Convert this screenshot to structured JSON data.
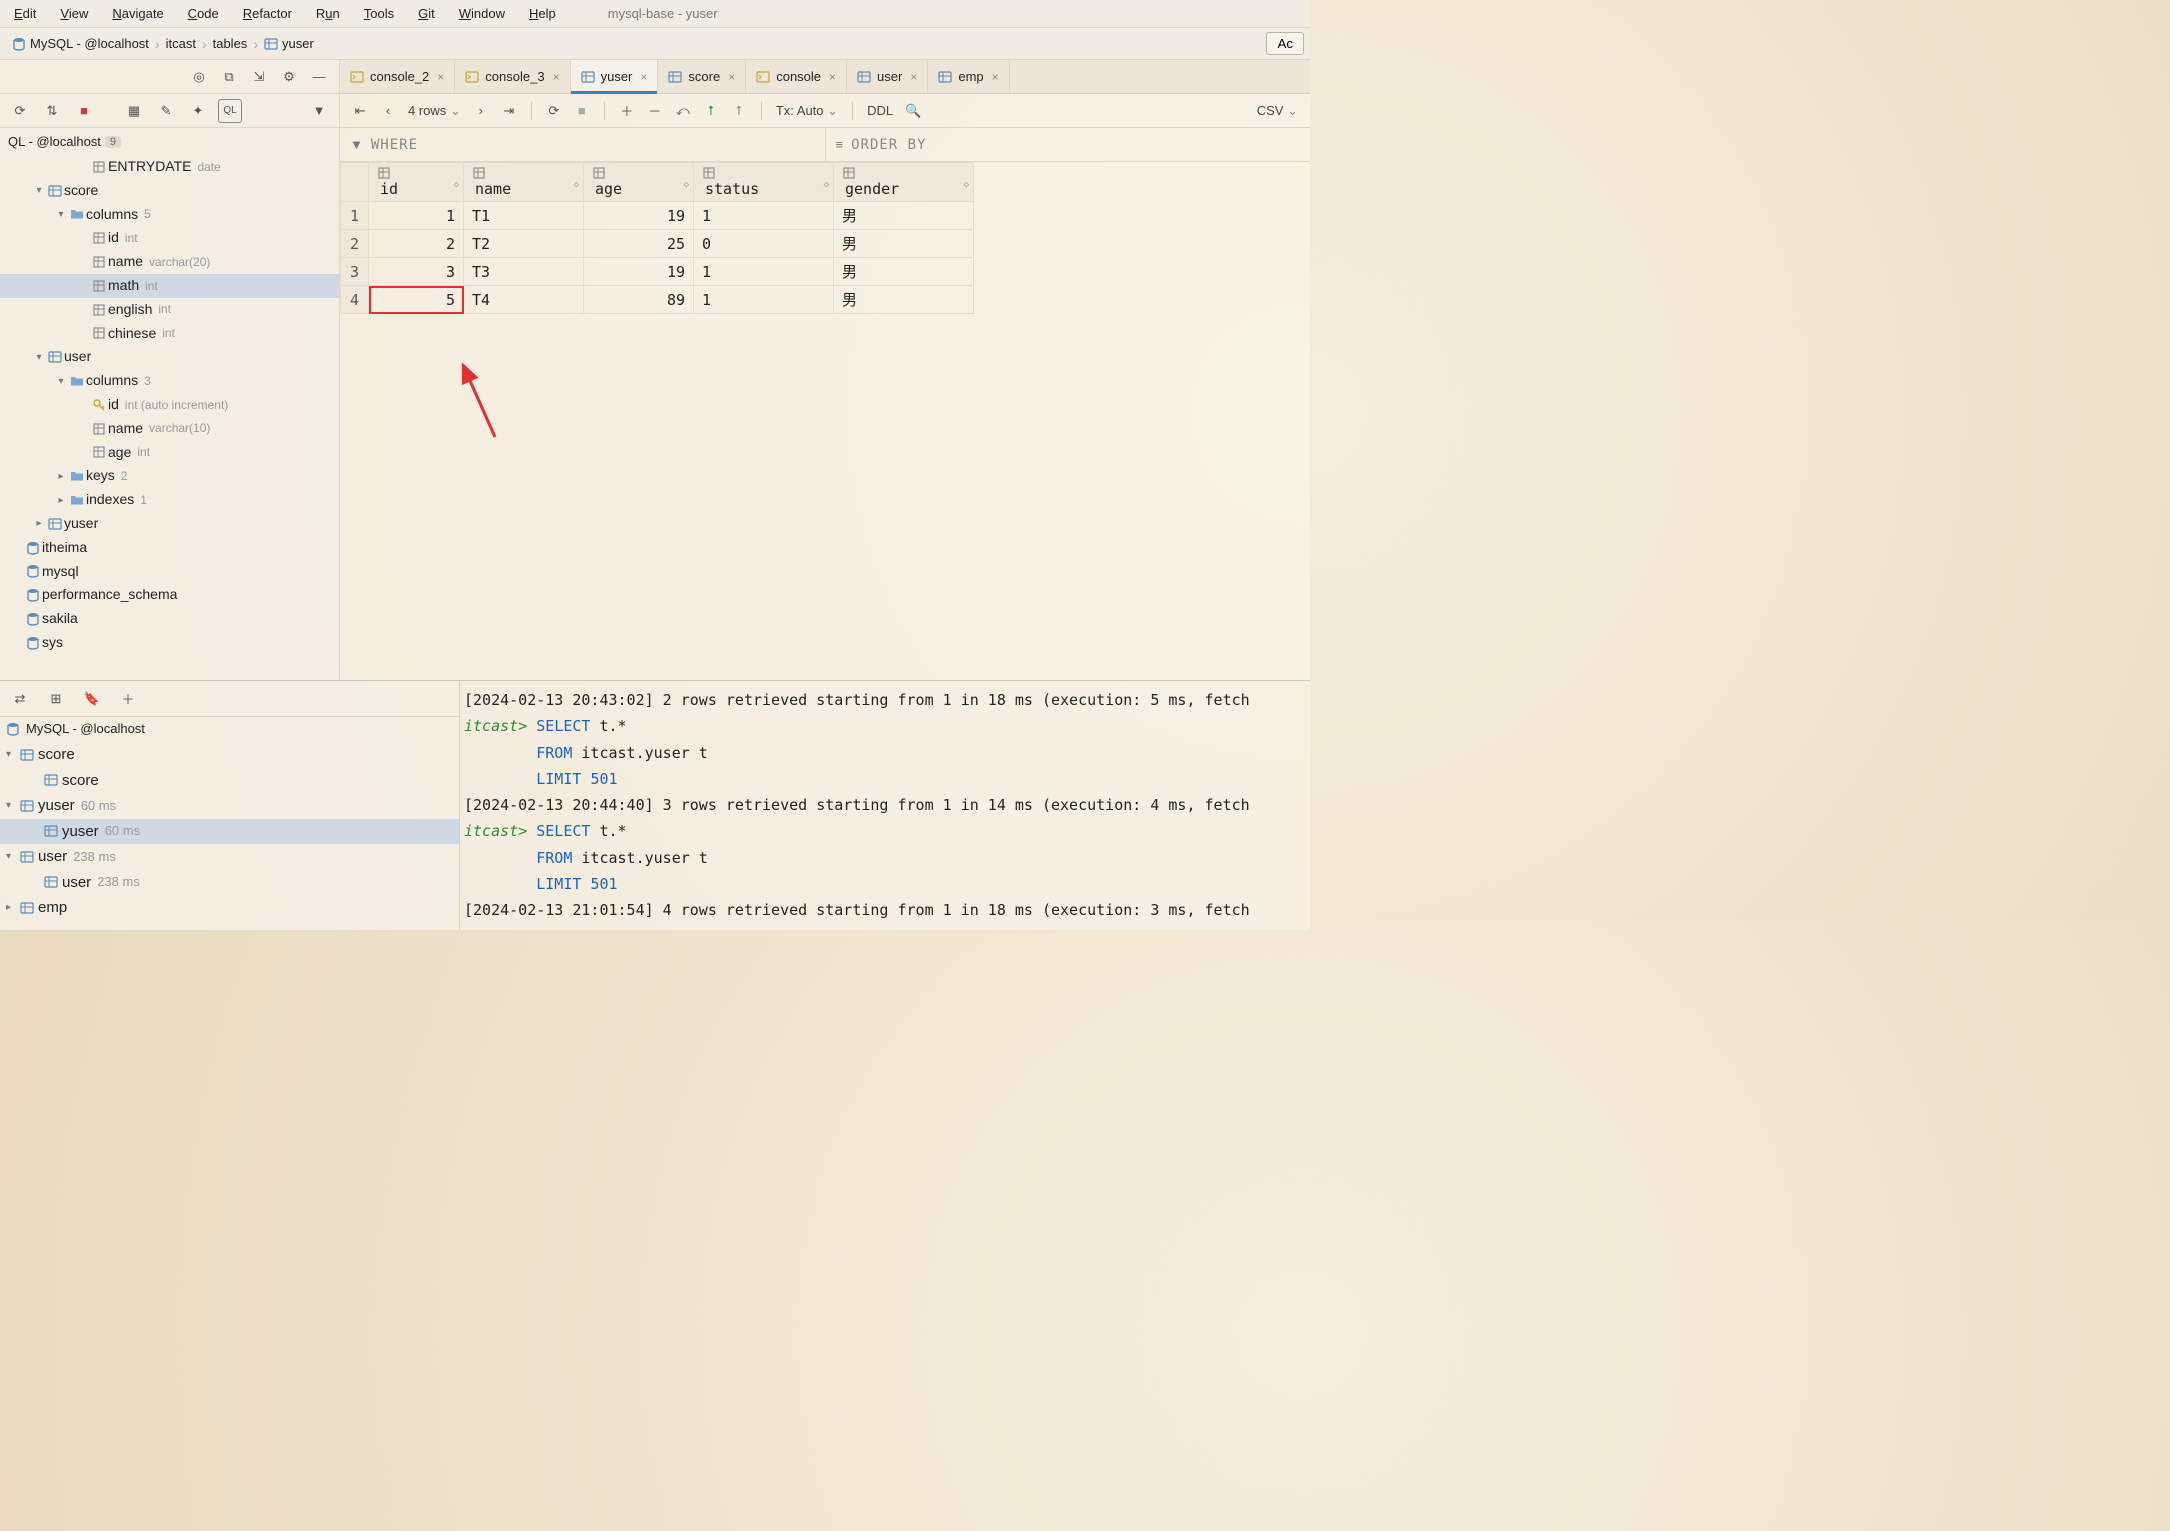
{
  "window_title": "mysql-base - yuser",
  "menu": [
    "Edit",
    "View",
    "Navigate",
    "Code",
    "Refactor",
    "Run",
    "Tools",
    "Git",
    "Window",
    "Help"
  ],
  "breadcrumbs": [
    "MySQL - @localhost",
    "itcast",
    "tables",
    "yuser"
  ],
  "toolbar_right_btn": "Ac",
  "sidebar": {
    "title": "QL - @localhost",
    "title_badge": "9",
    "tree": [
      {
        "depth": 3,
        "chev": "",
        "icon": "col",
        "label": "ENTRYDATE",
        "type": "date"
      },
      {
        "depth": 1,
        "chev": "▾",
        "icon": "tbl",
        "label": "score"
      },
      {
        "depth": 2,
        "chev": "▾",
        "icon": "folder",
        "label": "columns",
        "count": "5"
      },
      {
        "depth": 3,
        "chev": "",
        "icon": "col",
        "label": "id",
        "type": "int"
      },
      {
        "depth": 3,
        "chev": "",
        "icon": "col",
        "label": "name",
        "type": "varchar(20)"
      },
      {
        "depth": 3,
        "chev": "",
        "icon": "col",
        "label": "math",
        "type": "int",
        "selected": true
      },
      {
        "depth": 3,
        "chev": "",
        "icon": "col",
        "label": "english",
        "type": "int"
      },
      {
        "depth": 3,
        "chev": "",
        "icon": "col",
        "label": "chinese",
        "type": "int"
      },
      {
        "depth": 1,
        "chev": "▾",
        "icon": "tbl",
        "label": "user"
      },
      {
        "depth": 2,
        "chev": "▾",
        "icon": "folder",
        "label": "columns",
        "count": "3"
      },
      {
        "depth": 3,
        "chev": "",
        "icon": "key",
        "label": "id",
        "type": "int (auto increment)"
      },
      {
        "depth": 3,
        "chev": "",
        "icon": "col",
        "label": "name",
        "type": "varchar(10)"
      },
      {
        "depth": 3,
        "chev": "",
        "icon": "col",
        "label": "age",
        "type": "int"
      },
      {
        "depth": 2,
        "chev": "▸",
        "icon": "folder",
        "label": "keys",
        "count": "2"
      },
      {
        "depth": 2,
        "chev": "▸",
        "icon": "folder",
        "label": "indexes",
        "count": "1"
      },
      {
        "depth": 1,
        "chev": "▸",
        "icon": "tbl",
        "label": "yuser"
      },
      {
        "depth": 0,
        "chev": "",
        "icon": "db",
        "label": "itheima"
      },
      {
        "depth": 0,
        "chev": "",
        "icon": "db",
        "label": "mysql"
      },
      {
        "depth": 0,
        "chev": "",
        "icon": "db",
        "label": "performance_schema"
      },
      {
        "depth": 0,
        "chev": "",
        "icon": "db",
        "label": "sakila"
      },
      {
        "depth": 0,
        "chev": "",
        "icon": "db",
        "label": "sys"
      }
    ]
  },
  "tabs": [
    {
      "icon": "console",
      "label": "console_2",
      "active": false
    },
    {
      "icon": "console",
      "label": "console_3",
      "active": false
    },
    {
      "icon": "table",
      "label": "yuser",
      "active": true
    },
    {
      "icon": "table",
      "label": "score",
      "active": false
    },
    {
      "icon": "console",
      "label": "console",
      "active": false
    },
    {
      "icon": "table",
      "label": "user",
      "active": false
    },
    {
      "icon": "table",
      "label": "emp",
      "active": false
    }
  ],
  "grid_toolbar": {
    "row_label": "4 rows",
    "tx": "Tx: Auto",
    "ddl": "DDL",
    "format": "CSV"
  },
  "filters": {
    "where": "WHERE",
    "orderby": "ORDER BY"
  },
  "columns": [
    "id",
    "name",
    "age",
    "status",
    "gender"
  ],
  "rows": [
    {
      "id": "1",
      "name": "T1",
      "age": "19",
      "status": "1",
      "gender": "男"
    },
    {
      "id": "2",
      "name": "T2",
      "age": "25",
      "status": "0",
      "gender": "男"
    },
    {
      "id": "3",
      "name": "T3",
      "age": "19",
      "status": "1",
      "gender": "男"
    },
    {
      "id": "5",
      "name": "T4",
      "age": "89",
      "status": "1",
      "gender": "男"
    }
  ],
  "highlight_cell": {
    "row": 3,
    "col": "id"
  },
  "services": {
    "root": "MySQL - @localhost",
    "nodes": [
      {
        "chev": "▾",
        "icon": "tbl",
        "label": "score",
        "ms": "",
        "depth": 0
      },
      {
        "chev": "",
        "icon": "tbl",
        "label": "score",
        "ms": "",
        "depth": 1
      },
      {
        "chev": "▾",
        "icon": "tbl",
        "label": "yuser",
        "ms": "60 ms",
        "depth": 0
      },
      {
        "chev": "",
        "icon": "tbl",
        "label": "yuser",
        "ms": "60 ms",
        "depth": 1,
        "sel": true
      },
      {
        "chev": "▾",
        "icon": "tbl",
        "label": "user",
        "ms": "238 ms",
        "depth": 0
      },
      {
        "chev": "",
        "icon": "tbl",
        "label": "user",
        "ms": "238 ms",
        "depth": 1
      },
      {
        "chev": "▸",
        "icon": "tbl",
        "label": "emp",
        "ms": "",
        "depth": 0
      }
    ]
  },
  "console_log": [
    {
      "type": "msg",
      "text": "[2024-02-13 20:43:02] 2 rows retrieved starting from 1 in 18 ms (execution: 5 ms, fetch"
    },
    {
      "type": "prompt",
      "prompt": "itcast>",
      "sql": [
        "SELECT t.*",
        "FROM itcast.yuser t",
        "LIMIT 501"
      ]
    },
    {
      "type": "msg",
      "text": "[2024-02-13 20:44:40] 3 rows retrieved starting from 1 in 14 ms (execution: 4 ms, fetch"
    },
    {
      "type": "prompt",
      "prompt": "itcast>",
      "sql": [
        "SELECT t.*",
        "FROM itcast.yuser t",
        "LIMIT 501"
      ]
    },
    {
      "type": "msg",
      "text": "[2024-02-13 21:01:54] 4 rows retrieved starting from 1 in 18 ms (execution: 3 ms, fetch"
    }
  ]
}
